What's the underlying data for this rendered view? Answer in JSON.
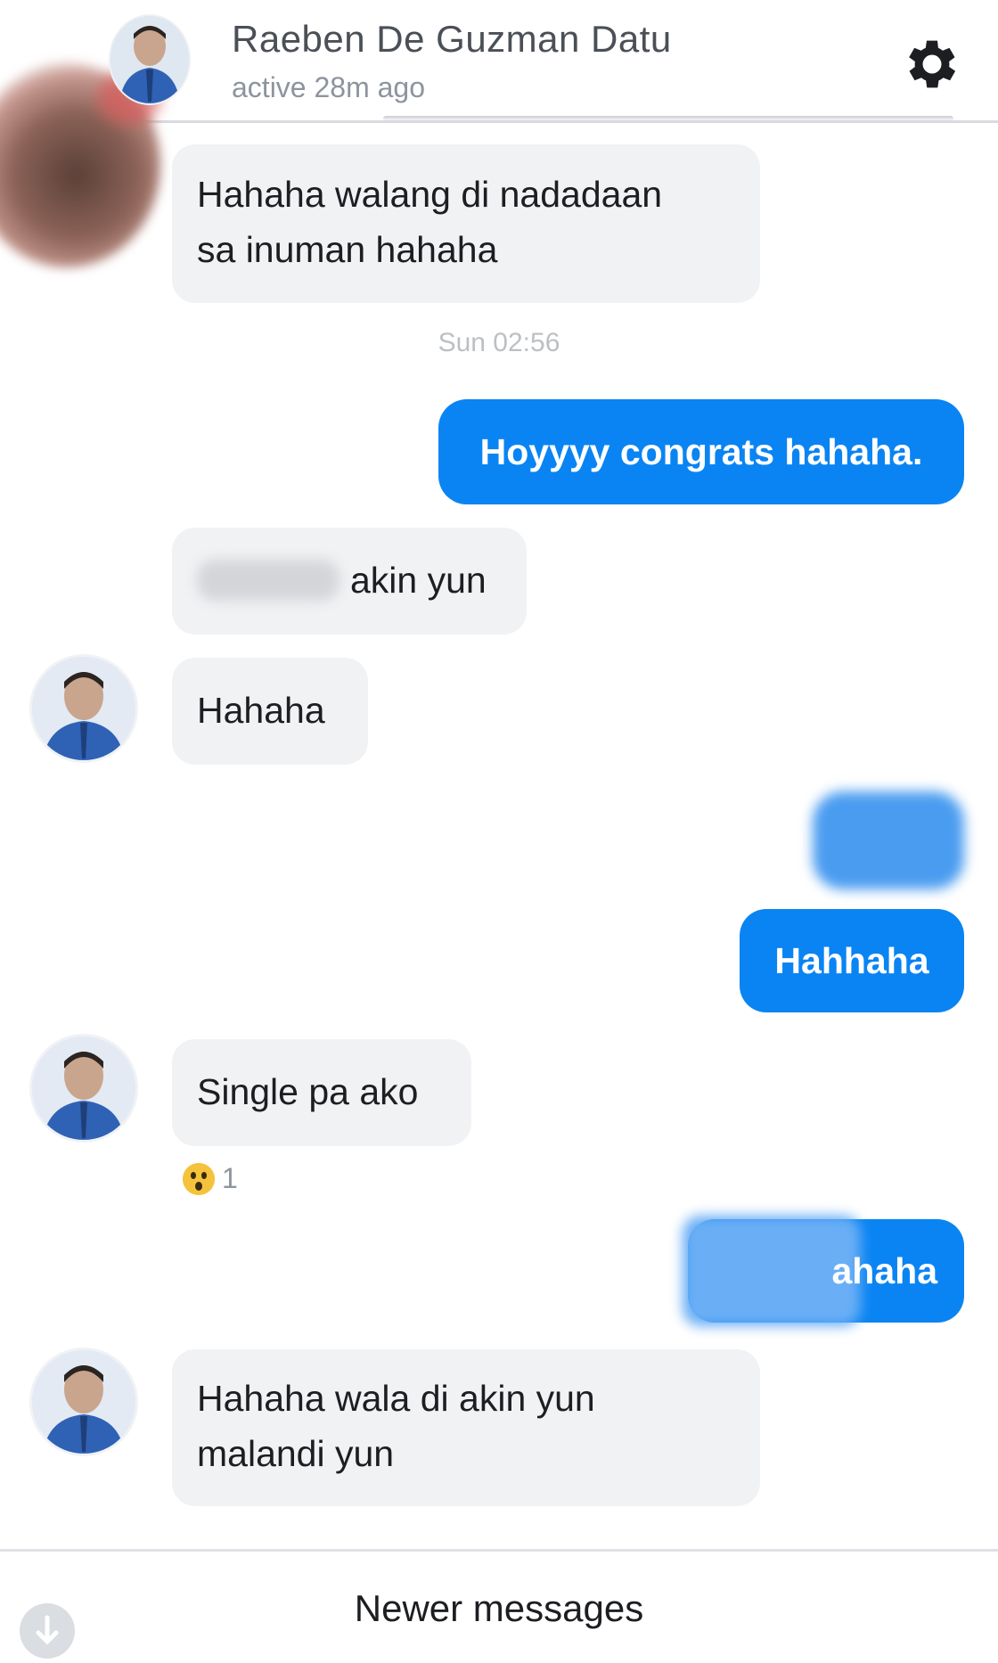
{
  "header": {
    "contact_name": "Raeben De Guzman Datu",
    "status": "active 28m ago",
    "settings_icon": "gear-icon"
  },
  "messages": {
    "m1_line1": "Hahaha walang di nadadaan",
    "m1_line2": "sa inuman hahaha",
    "timestamp": "Sun 02:56",
    "m2": "Hoyyyy congrats hahaha.",
    "m3_visible": "akin yun",
    "m4": "Hahaha",
    "m6": "Hahhaha",
    "m7": "Single pa ako",
    "m7_reaction_count": "1",
    "m7_reaction_icon": "wow-emoji-icon",
    "m8_visible": "ahaha",
    "m9_line1": "Hahaha wala di akin yun",
    "m9_line2": "malandi yun"
  },
  "footer": {
    "newer_messages": "Newer messages"
  },
  "colors": {
    "outgoing_bubble": "#0a84f3",
    "incoming_bubble": "#f1f2f4",
    "text": "#1c1e21",
    "muted": "#8d949e"
  }
}
